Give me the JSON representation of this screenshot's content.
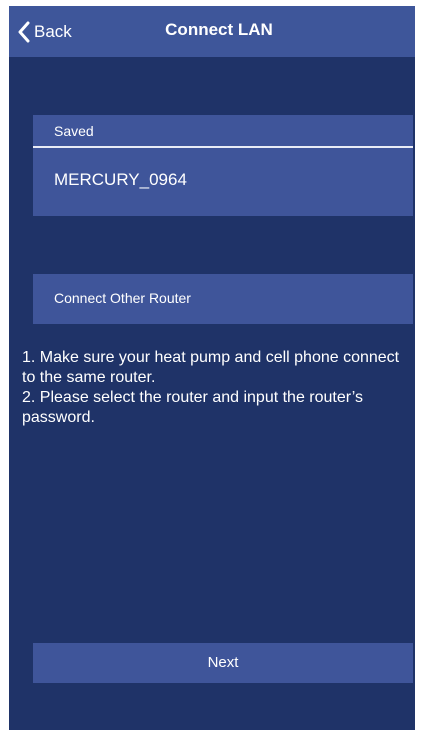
{
  "navbar": {
    "back_label": "Back",
    "back_icon": "chevron-left-icon",
    "title": "Connect LAN"
  },
  "saved": {
    "header": "Saved",
    "items": [
      {
        "label": "MERCURY_0964"
      }
    ]
  },
  "other_router": {
    "label": "Connect Other Router"
  },
  "instructions": {
    "line1": "1. Make sure your heat pump and cell phone connect to the same router.",
    "line2": "2. Please select the router and input the router’s password."
  },
  "footer": {
    "next_label": "Next"
  },
  "colors": {
    "background": "#1f3368",
    "navbar": "#3e569a",
    "panel": "#3f559a",
    "text": "#ffffff"
  }
}
